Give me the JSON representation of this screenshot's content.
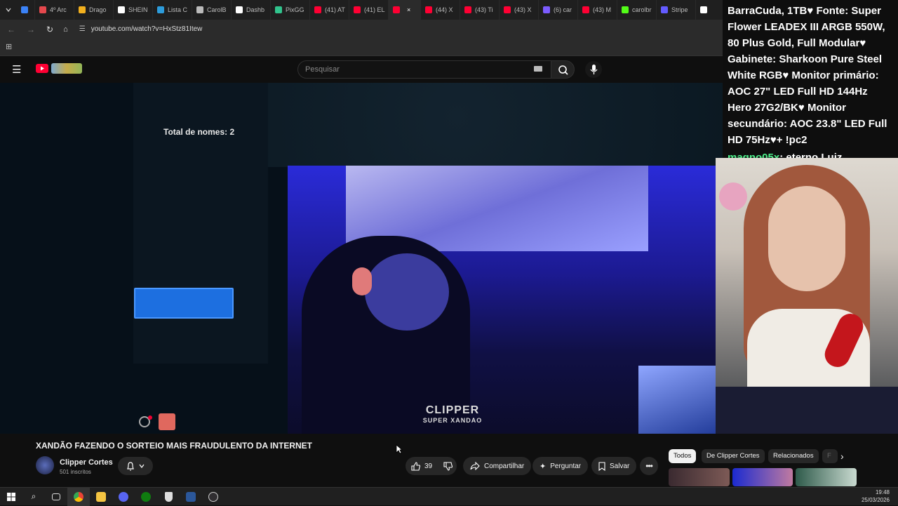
{
  "browser": {
    "tabs": [
      {
        "label": "",
        "color": "#3b82f6"
      },
      {
        "label": "4º Arc",
        "color": "#e5484d"
      },
      {
        "label": "Drago",
        "color": "#f2b01e"
      },
      {
        "label": "SHEIN",
        "color": "#ffffff"
      },
      {
        "label": "Lista C",
        "color": "#2d9cdb"
      },
      {
        "label": "CarolB",
        "color": "#bbbbbb"
      },
      {
        "label": "Dashb",
        "color": "#ffffff"
      },
      {
        "label": "PixGG",
        "color": "#31c48d"
      },
      {
        "label": "(41) AT",
        "color": "#ff0033"
      },
      {
        "label": "(41) EL",
        "color": "#ff0033"
      },
      {
        "label": "",
        "color": "#ff0033",
        "active": true
      },
      {
        "label": "(44) X",
        "color": "#ff0033"
      },
      {
        "label": "(43) Ti",
        "color": "#ff0033"
      },
      {
        "label": "(43) X",
        "color": "#ff0033"
      },
      {
        "label": "(6) car",
        "color": "#7c5cff"
      },
      {
        "label": "(43) M",
        "color": "#ff0033"
      },
      {
        "label": "carolbr",
        "color": "#53fc18"
      },
      {
        "label": "Stripe",
        "color": "#635bff"
      },
      {
        "label": "",
        "color": "#ffffff"
      }
    ],
    "url": "youtube.com/watch?v=HxStz81Itew"
  },
  "youtube": {
    "search_placeholder": "Pesquisar",
    "video_title": "XANDÃO FAZENDO O SORTEIO MAIS FRAUDULENTO DA INTERNET",
    "channel_name": "Clipper Cortes",
    "channel_subs": "501 inscritos",
    "like_count": "39",
    "share_label": "Compartilhar",
    "ask_label": "Perguntar",
    "save_label": "Salvar",
    "chips": [
      "Todos",
      "De Clipper Cortes",
      "Relacionados",
      "F"
    ]
  },
  "stream_overlay": {
    "chat_text": "BarraCuda, 1TB♥ Fonte: Super Flower LEADEX III ARGB 550W, 80 Plus Gold, Full Modular♥ Gabinete: Sharkoon Pure Steel White RGB♥ Monitor primário: AOC 27\" LED Full HD 144Hz Hero 27G2/BK♥ Monitor secundário: AOC 23.8\" LED Full HD 75Hz♥+ !pc2",
    "chat_user": "magno05x",
    "chat_message": ": eterno Luiz",
    "names_total": "Total de nomes: 2",
    "watermark": "CLIPPER",
    "watermark_sub": "SUPER XANDAO"
  },
  "taskbar": {
    "time": "19:48",
    "date": "25/03/2026"
  }
}
